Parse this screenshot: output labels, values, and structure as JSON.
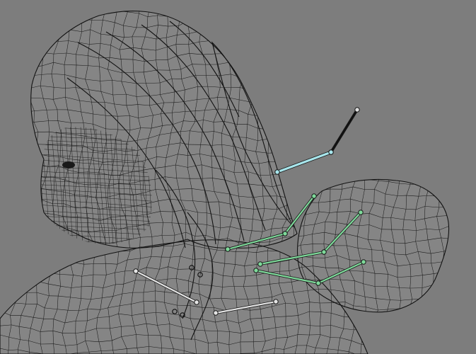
{
  "viewport": {
    "background": "#7d7d7d",
    "mesh_color": "#1c1c1c",
    "subject": "character-wireframe-mesh"
  },
  "bones": {
    "selected_color": "#a8e6ec",
    "green_color": "#7ed99a",
    "white_color": "#e4e4e4",
    "black_color": "#101010",
    "joint_fill": "#dcdcdc"
  },
  "icons": {
    "joint": "bone-joint-icon"
  }
}
